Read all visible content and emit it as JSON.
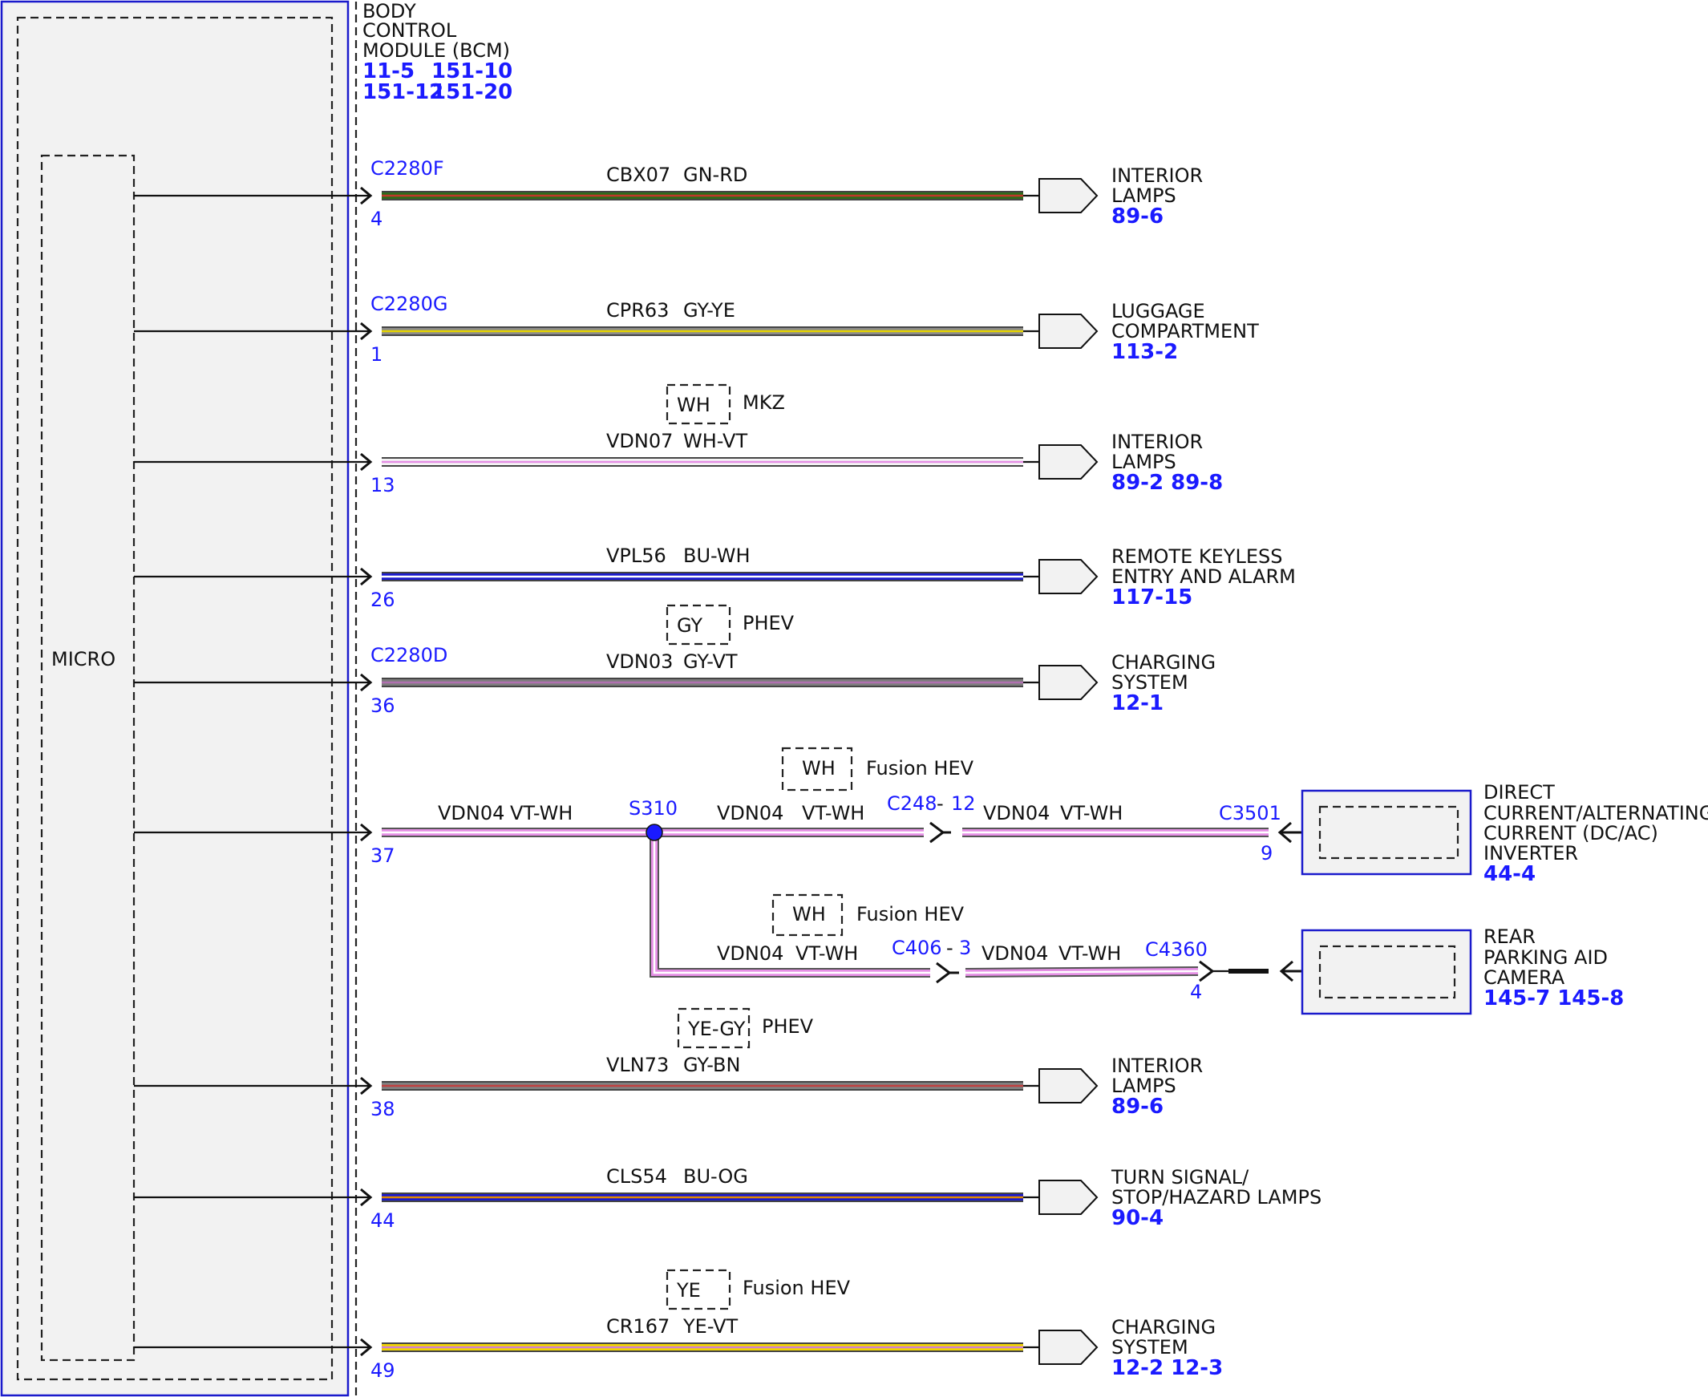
{
  "module": {
    "title_lines": [
      "BODY",
      "CONTROL",
      "MODULE (BCM)"
    ],
    "refs_line1": [
      "11-5",
      "151-10"
    ],
    "refs_line2": [
      "151-12",
      "151-20"
    ],
    "micro_label": "MICRO"
  },
  "circuits": [
    {
      "connector": "C2280F",
      "pin": "4",
      "wire": "CBX07",
      "color_code": "GN-RD",
      "colors": [
        "#2e6b1a",
        "#c0392b"
      ],
      "dest_lines": [
        "INTERIOR",
        "LAMPS"
      ],
      "dest_refs": "89-6"
    },
    {
      "connector": "C2280G",
      "pin": "1",
      "wire": "CPR63",
      "color_code": "GY-YE",
      "colors": [
        "#8c8c8c",
        "#e6d400"
      ],
      "dest_lines": [
        "LUGGAGE",
        "COMPARTMENT"
      ],
      "dest_refs": "113-2"
    },
    {
      "connector": "",
      "pin": "13",
      "wire": "VDN07",
      "color_code": "WH-VT",
      "colors": [
        "#f4f4f4",
        "#e58fe5"
      ],
      "dest_lines": [
        "INTERIOR",
        "LAMPS"
      ],
      "dest_refs": "89-2   89-8",
      "option": {
        "box": "WH",
        "label": "MKZ"
      }
    },
    {
      "connector": "",
      "pin": "26",
      "wire": "VPL56",
      "color_code": "BU-WH",
      "colors": [
        "#1a1acc",
        "#ffffff"
      ],
      "dest_lines": [
        "REMOTE KEYLESS",
        "ENTRY AND ALARM"
      ],
      "dest_refs": "117-15"
    },
    {
      "connector": "C2280D",
      "pin": "36",
      "wire": "VDN03",
      "color_code": "GY-VT",
      "colors": [
        "#7d7d7d",
        "#b070b0"
      ],
      "dest_lines": [
        "CHARGING",
        "SYSTEM"
      ],
      "dest_refs": "12-1",
      "option": {
        "box": "GY",
        "label": "PHEV"
      }
    },
    {
      "connector": "",
      "pin": "38",
      "wire": "VLN73",
      "color_code": "GY-BN",
      "colors": [
        "#808080",
        "#c04040"
      ],
      "dest_lines": [
        "INTERIOR",
        "LAMPS"
      ],
      "dest_refs": "89-6",
      "option": {
        "box": "YE-GY",
        "label": "PHEV"
      }
    },
    {
      "connector": "",
      "pin": "44",
      "wire": "CLS54",
      "color_code": "BU-OG",
      "colors": [
        "#1a1acc",
        "#e08a00"
      ],
      "dest_lines": [
        "TURN SIGNAL/",
        "STOP/HAZARD LAMPS"
      ],
      "dest_refs": "90-4"
    },
    {
      "connector": "",
      "pin": "49",
      "wire": "CR167",
      "color_code": "YE-VT",
      "colors": [
        "#f2d500",
        "#d080d0"
      ],
      "dest_lines": [
        "CHARGING",
        "SYSTEM"
      ],
      "dest_refs": "12-2   12-3",
      "option": {
        "box": "YE",
        "label": "Fusion HEV"
      }
    }
  ],
  "splice": {
    "pin": "37",
    "wire": "VDN04",
    "color_code": "VT-WH",
    "splice_id": "S310",
    "upper_inline": {
      "connector": "C248",
      "pin": "12"
    },
    "upper_end": {
      "connector": "C3501",
      "pin": "9"
    },
    "upper_option": {
      "box": "WH",
      "label": "Fusion HEV"
    },
    "upper_dest_lines": [
      "DIRECT",
      "CURRENT/ALTERNATING",
      "CURRENT (DC/AC)",
      "INVERTER"
    ],
    "upper_dest_refs": "44-4",
    "lower_inline": {
      "connector": "C406",
      "pin": "3"
    },
    "lower_end": {
      "connector": "C4360",
      "pin": "4"
    },
    "lower_option": {
      "box": "WH",
      "label": "Fusion HEV"
    },
    "lower_dest_lines": [
      "REAR",
      "PARKING AID",
      "CAMERA"
    ],
    "lower_dest_refs": "145-7 145-8"
  }
}
